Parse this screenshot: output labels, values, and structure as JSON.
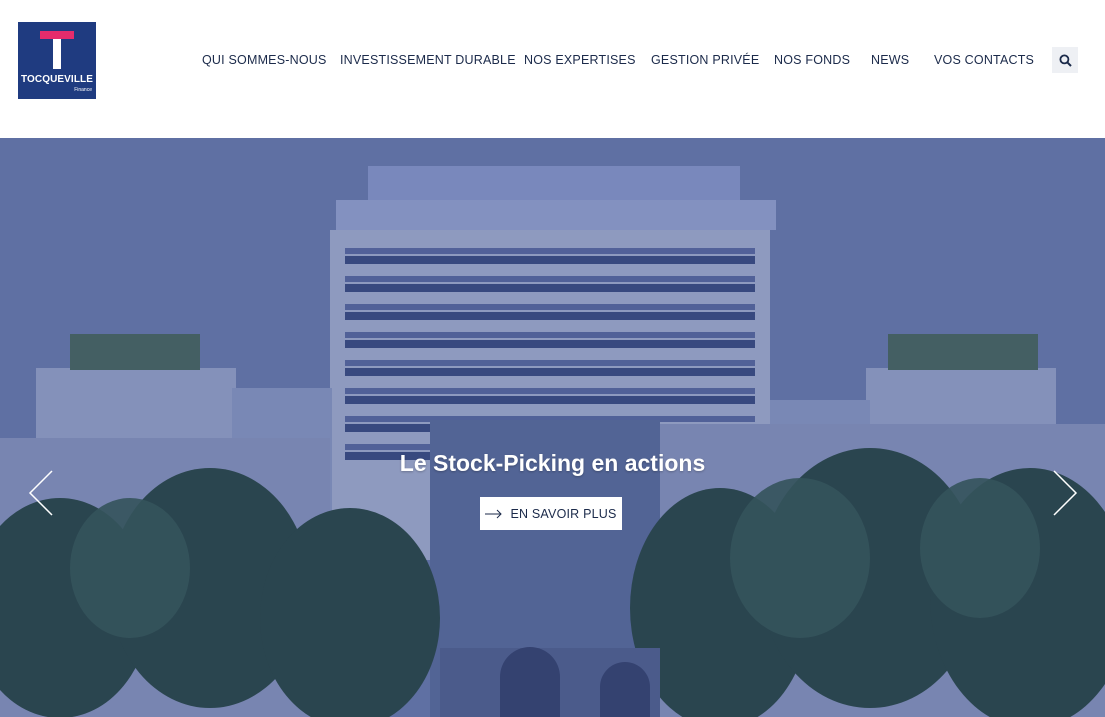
{
  "brand": {
    "name": "TOCQUEVILLE",
    "sub": "Finance",
    "colors": {
      "navy": "#1f3b80",
      "pink": "#e52c6c"
    }
  },
  "nav": {
    "items": [
      {
        "label": "QUI SOMMES-NOUS"
      },
      {
        "label": "INVESTISSEMENT DURABLE"
      },
      {
        "label": "NOS EXPERTISES"
      },
      {
        "label": "GESTION PRIVÉE"
      },
      {
        "label": "NOS FONDS"
      },
      {
        "label": "NEWS"
      },
      {
        "label": "VOS CONTACTS"
      }
    ],
    "search_icon": "search-icon"
  },
  "hero": {
    "title": "Le Stock-Picking en actions",
    "cta_label": "EN SAVOIR PLUS",
    "cta_icon": "arrow-right-icon",
    "prev_icon": "chevron-left-icon",
    "next_icon": "chevron-right-icon"
  }
}
